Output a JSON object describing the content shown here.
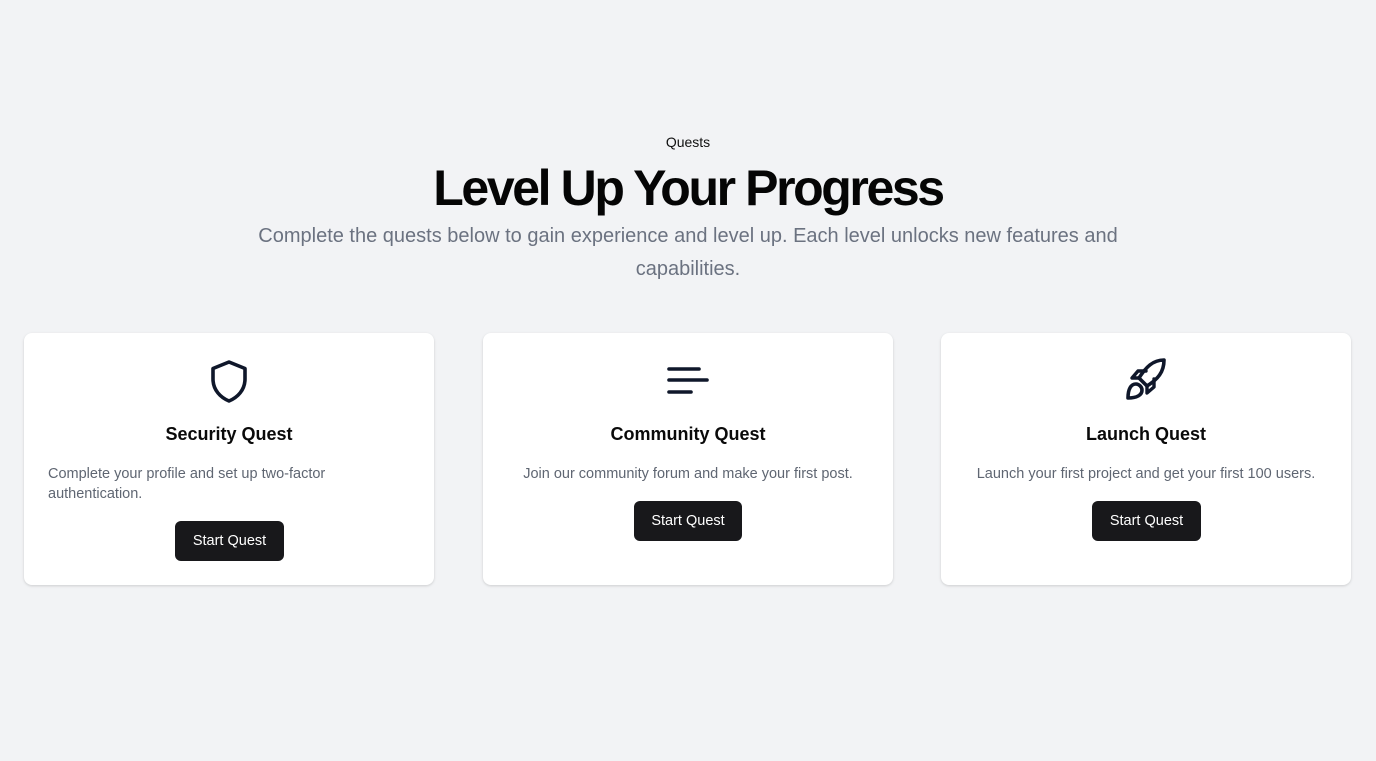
{
  "header": {
    "eyebrow": "Quests",
    "title": "Level Up Your Progress",
    "subtitle": "Complete the quests below to gain experience and level up. Each level unlocks new features and capabilities."
  },
  "colors": {
    "background": "#f2f3f5",
    "card": "#ffffff",
    "button": "#18181b",
    "button_text": "#ffffff",
    "muted_text": "#6b7280",
    "icon": "#0f172a"
  },
  "quests": [
    {
      "icon": "shield-icon",
      "title": "Security Quest",
      "description": "Complete your profile and set up two-factor authentication.",
      "button_label": "Start Quest"
    },
    {
      "icon": "align-left-icon",
      "title": "Community Quest",
      "description": "Join our community forum and make your first post.",
      "button_label": "Start Quest"
    },
    {
      "icon": "rocket-icon",
      "title": "Launch Quest",
      "description": "Launch your first project and get your first 100 users.",
      "button_label": "Start Quest"
    }
  ]
}
